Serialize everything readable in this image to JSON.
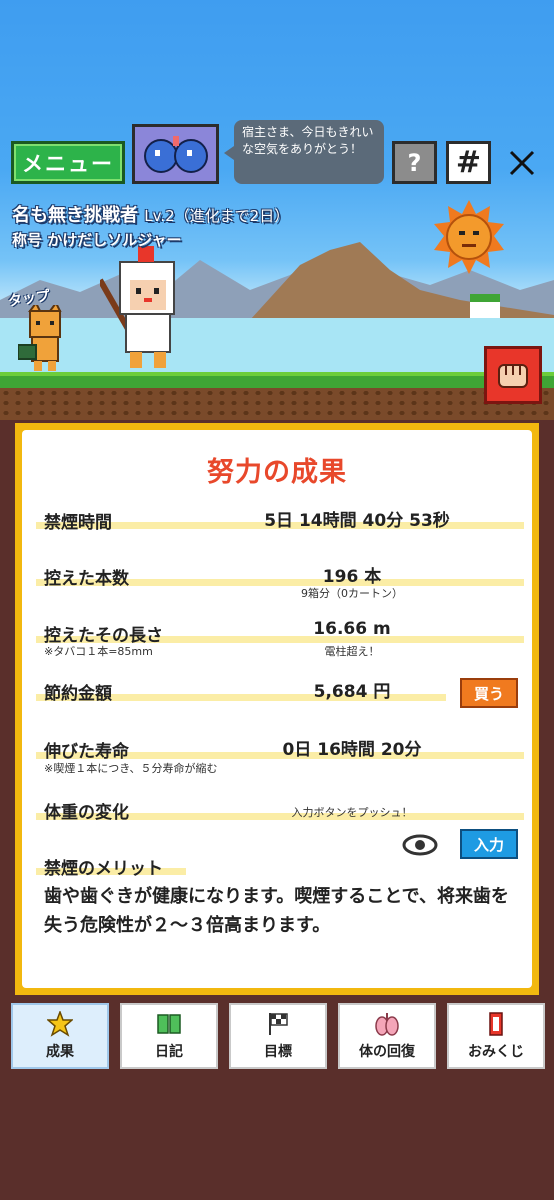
{
  "header": {
    "menu_label": "メニュー",
    "bubble_text": "宿主さま、今日もきれいな空気をありがとう！",
    "help_label": "?",
    "hash_label": "#",
    "x_label": "X"
  },
  "player": {
    "name": "名も無き挑戦者",
    "level": "Lv.2（進化まで2日）",
    "title": "称号 かけだしソルジャー",
    "tap": "タップ"
  },
  "card": {
    "title": "努力の成果",
    "rows": [
      {
        "label": "禁煙時間",
        "value": "5日 14時間 40分 53秒"
      },
      {
        "label": "控えた本数",
        "value": "196 本",
        "sub": "9箱分（0カートン）"
      },
      {
        "label": "控えたその長さ",
        "value": "16.66 m",
        "sub": "電柱超え！",
        "note": "※タバコ１本=85mm"
      },
      {
        "label": "節約金額",
        "value": "5,684 円",
        "button": "買う"
      },
      {
        "label": "伸びた寿命",
        "value": "0日 16時間 20分",
        "note": "※喫煙１本につき、５分寿命が縮む"
      },
      {
        "label": "体重の変化",
        "value": "入力ボタンをプッシュ！",
        "button": "入力"
      }
    ],
    "merit_label": "禁煙のメリット",
    "merit_text": "歯や歯ぐきが健康になります。喫煙することで、将来歯を失う危険性が２〜３倍高まります。"
  },
  "nav": [
    {
      "label": "成果",
      "icon": "star-icon"
    },
    {
      "label": "日記",
      "icon": "book-icon"
    },
    {
      "label": "目標",
      "icon": "flag-icon"
    },
    {
      "label": "体の回復",
      "icon": "lungs-icon"
    },
    {
      "label": "おみくじ",
      "icon": "omikuji-icon"
    }
  ],
  "colors": {
    "accent_red": "#e8482b",
    "menu_green": "#2db34a",
    "card_border": "#f2b80f",
    "buy_orange": "#f07a1f",
    "input_blue": "#1e9be3"
  }
}
